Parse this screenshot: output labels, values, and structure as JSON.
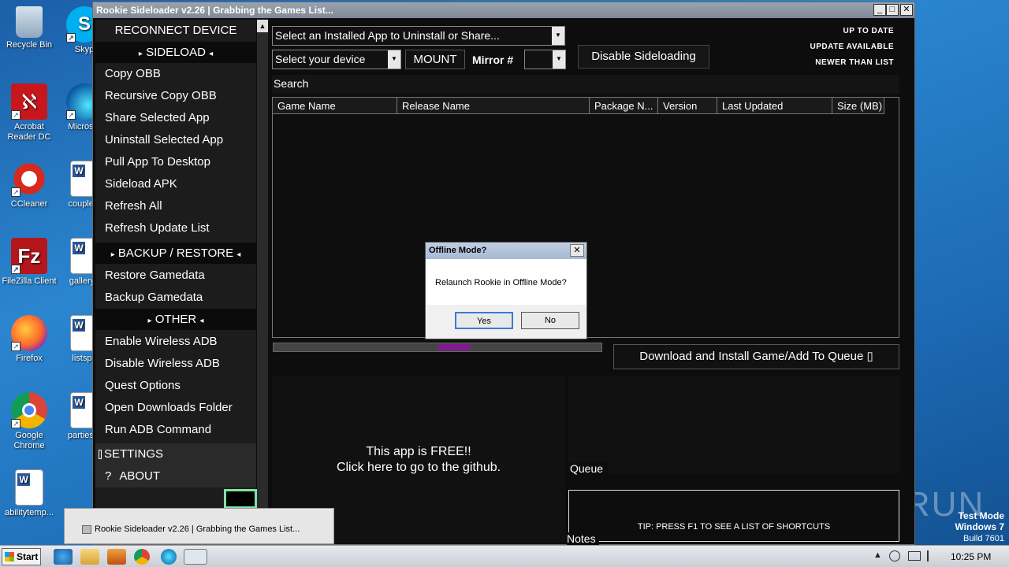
{
  "desktop": {
    "icons": [
      {
        "label": "Recycle Bin",
        "icon": "recycle-bin-icon"
      },
      {
        "label": "Acrobat Reader DC",
        "icon": "acrobat-icon"
      },
      {
        "label": "CCleaner",
        "icon": "ccleaner-icon"
      },
      {
        "label": "FileZilla Client",
        "icon": "filezilla-icon"
      },
      {
        "label": "Firefox",
        "icon": "firefox-icon"
      },
      {
        "label": "Google Chrome",
        "icon": "chrome-icon"
      },
      {
        "label": "abilitytemp...",
        "icon": "word-doc-icon"
      },
      {
        "label": "Skyp",
        "icon": "skype-icon"
      },
      {
        "label": "Microsof",
        "icon": "edge-icon"
      },
      {
        "label": "couplegl",
        "icon": "word-doc-icon"
      },
      {
        "label": "galleryn",
        "icon": "word-doc-icon"
      },
      {
        "label": "listsph",
        "icon": "word-doc-icon"
      },
      {
        "label": "partiesm",
        "icon": "word-doc-icon"
      }
    ]
  },
  "window": {
    "title": "Rookie Sideloader v2.26 | Grabbing the Games List...",
    "min": "_",
    "max": "□",
    "close": "✕"
  },
  "sidebar": {
    "reconnect": "RECONNECT DEVICE",
    "sideload_hdr": "SIDELOAD",
    "sideload_items": [
      "Copy OBB",
      "Recursive Copy OBB",
      "Share Selected App",
      "Uninstall Selected App",
      "Pull App To Desktop",
      "Sideload APK",
      "Refresh All",
      "Refresh Update List"
    ],
    "backup_hdr": "BACKUP / RESTORE",
    "backup_items": [
      "Restore Gamedata",
      "Backup Gamedata"
    ],
    "other_hdr": "OTHER",
    "other_items": [
      "Enable  Wireless ADB",
      "Disable Wireless ADB",
      "Quest Options",
      "Open Downloads Folder",
      "Run ADB Command"
    ],
    "settings": "SETTINGS",
    "about_icon": "?",
    "about": "ABOUT",
    "arrow_left": "▸",
    "arrow_right": "◂"
  },
  "toolbar": {
    "installed_placeholder": "Select an Installed App to Uninstall or Share...",
    "device_placeholder": "Select your device",
    "mount": "MOUNT",
    "mirror_label": "Mirror #",
    "mirror_value": "",
    "disable_sideloading": "Disable Sideloading",
    "dropdown_glyph": "▼"
  },
  "status_legend": {
    "up_to_date": "UP TO DATE",
    "update_available": "UPDATE AVAILABLE",
    "newer_than_list": "NEWER THAN LIST"
  },
  "search": {
    "label": "Search"
  },
  "table": {
    "columns": [
      "Game Name",
      "Release Name",
      "Package N...",
      "Version",
      "Last Updated",
      "Size (MB)"
    ],
    "rows": []
  },
  "progress": {
    "fill_fraction_start": 0.5,
    "fill_fraction_end": 0.6
  },
  "download_button": "Download and Install Game/Add To Queue ▯",
  "free_banner": {
    "line1": "This app is FREE!!",
    "line2": "Click here to go to the github."
  },
  "queue_label": "Queue",
  "notes_label": "Notes",
  "tip": "TIP: PRESS F1 TO SEE A LIST OF SHORTCUTS",
  "dialog": {
    "title": "Offline Mode?",
    "message": "Relaunch Rookie in Offline Mode?",
    "yes": "Yes",
    "no": "No",
    "close": "✕"
  },
  "taskbar": {
    "start": "Start",
    "thumbnail_title": "Rookie Sideloader v2.26 | Grabbing the Games List...",
    "clock": "10:25 PM"
  },
  "watermark": {
    "brand": "ANY RUN",
    "mode": "Test Mode",
    "os": "Windows 7",
    "build": "Build 7601"
  }
}
